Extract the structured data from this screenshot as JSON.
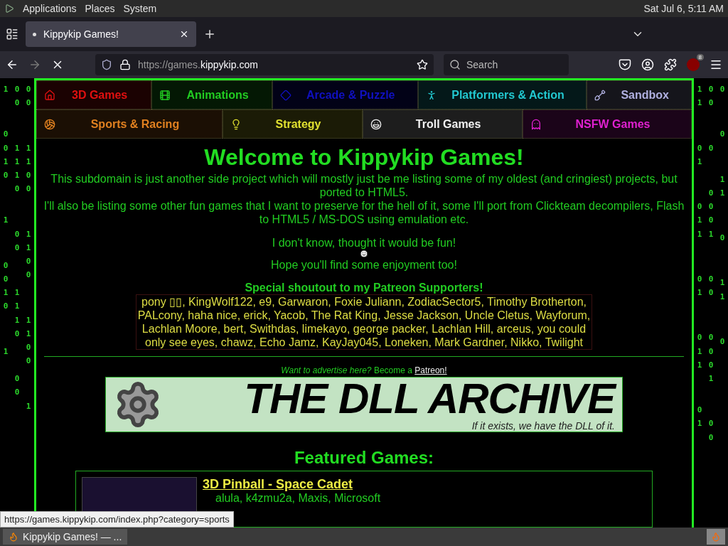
{
  "top_panel": {
    "menus": [
      "Applications",
      "Places",
      "System"
    ],
    "clock": "Sat Jul  6,  5:11 AM"
  },
  "browser": {
    "tab": {
      "title": "Kippykip Games!",
      "selected": true
    },
    "url": {
      "prefix": "https://games.",
      "domain": "kippykip.com"
    },
    "search": {
      "placeholder": "Search"
    },
    "extension_badge": "8"
  },
  "matrix_rain": {
    "left_columns": [
      [
        "1",
        "0010",
        "1",
        "0010",
        "1"
      ],
      [
        "00",
        "1110",
        "00",
        "1110",
        "00"
      ],
      [
        "00",
        "1100",
        "1100",
        "1100",
        "1"
      ]
    ],
    "right_columns": [
      [
        "11",
        "01",
        "011",
        "01",
        "011",
        "01"
      ],
      [
        "00",
        "0",
        "0001",
        "00",
        "0001",
        "00"
      ],
      [
        "0",
        "0",
        "11",
        "0",
        "11",
        "0"
      ]
    ]
  },
  "nav": {
    "categories": [
      {
        "label": "3D Games",
        "color": "#e01010"
      },
      {
        "label": "Animations",
        "color": "#22cc22"
      },
      {
        "label": "Arcade & Puzzle",
        "color": "#1010c0"
      },
      {
        "label": "Platformers & Action",
        "color": "#22c8d0"
      },
      {
        "label": "Sandbox",
        "color": "#b0b0e0"
      },
      {
        "label": "Sports & Racing",
        "color": "#e08020"
      },
      {
        "label": "Strategy",
        "color": "#e0e030"
      },
      {
        "label": "Troll Games",
        "color": "#f0f0f0"
      },
      {
        "label": "NSFW Games",
        "color": "#e020d0"
      }
    ]
  },
  "welcome": {
    "title": "Welcome to Kippykip Games!",
    "paragraphs": [
      "This subdomain is just another side project which will mostly just be me listing some of my oldest (and cringiest) projects, but ported to HTML5.",
      "I'll also be listing some other fun games that I want to preserve for the hell of it, some I'll port from Clickteam decompilers, Flash to HTML5 / MS-DOS using emulation etc."
    ],
    "fun_line": "I don't know, thought it would be fun!",
    "enjoy_line": "Hope you'll find some enjoyment too!"
  },
  "shoutout": {
    "heading": "Special shoutout to my Patreon Supporters!",
    "supporters": "pony ▯▯, KingWolf122, e9, Garwaron, Foxie Juliann, ZodiacSector5, Timothy Brotherton, PALcony, haha nice, erick, Yacob, The Rat King, Jesse Jackson, Uncle Cletus, Wayforum, Lachlan Moore, bert, Swithdas, limekayo, george packer, Lachlan Hill, arceus, you could only see eyes, chawz, Echo Jamz, KayJay045, Loneken, Mark Gardner, Nikko, Twilight"
  },
  "advert": {
    "question": "Want to advertise here?",
    "prompt": "Become a",
    "link": "Patreon!",
    "banner_title": "THE DLL ARCHIVE",
    "banner_tagline": "If it exists, we have the DLL of it."
  },
  "featured": {
    "heading": "Featured Games:",
    "games": [
      {
        "title": "3D Pinball - Space Cadet",
        "credits": "alula, k4zmu2a, Maxis, Microsoft"
      }
    ]
  },
  "status_url": "https://games.kippykip.com/index.php?category=sports",
  "taskbar": {
    "window": "Kippykip Games! — ..."
  }
}
